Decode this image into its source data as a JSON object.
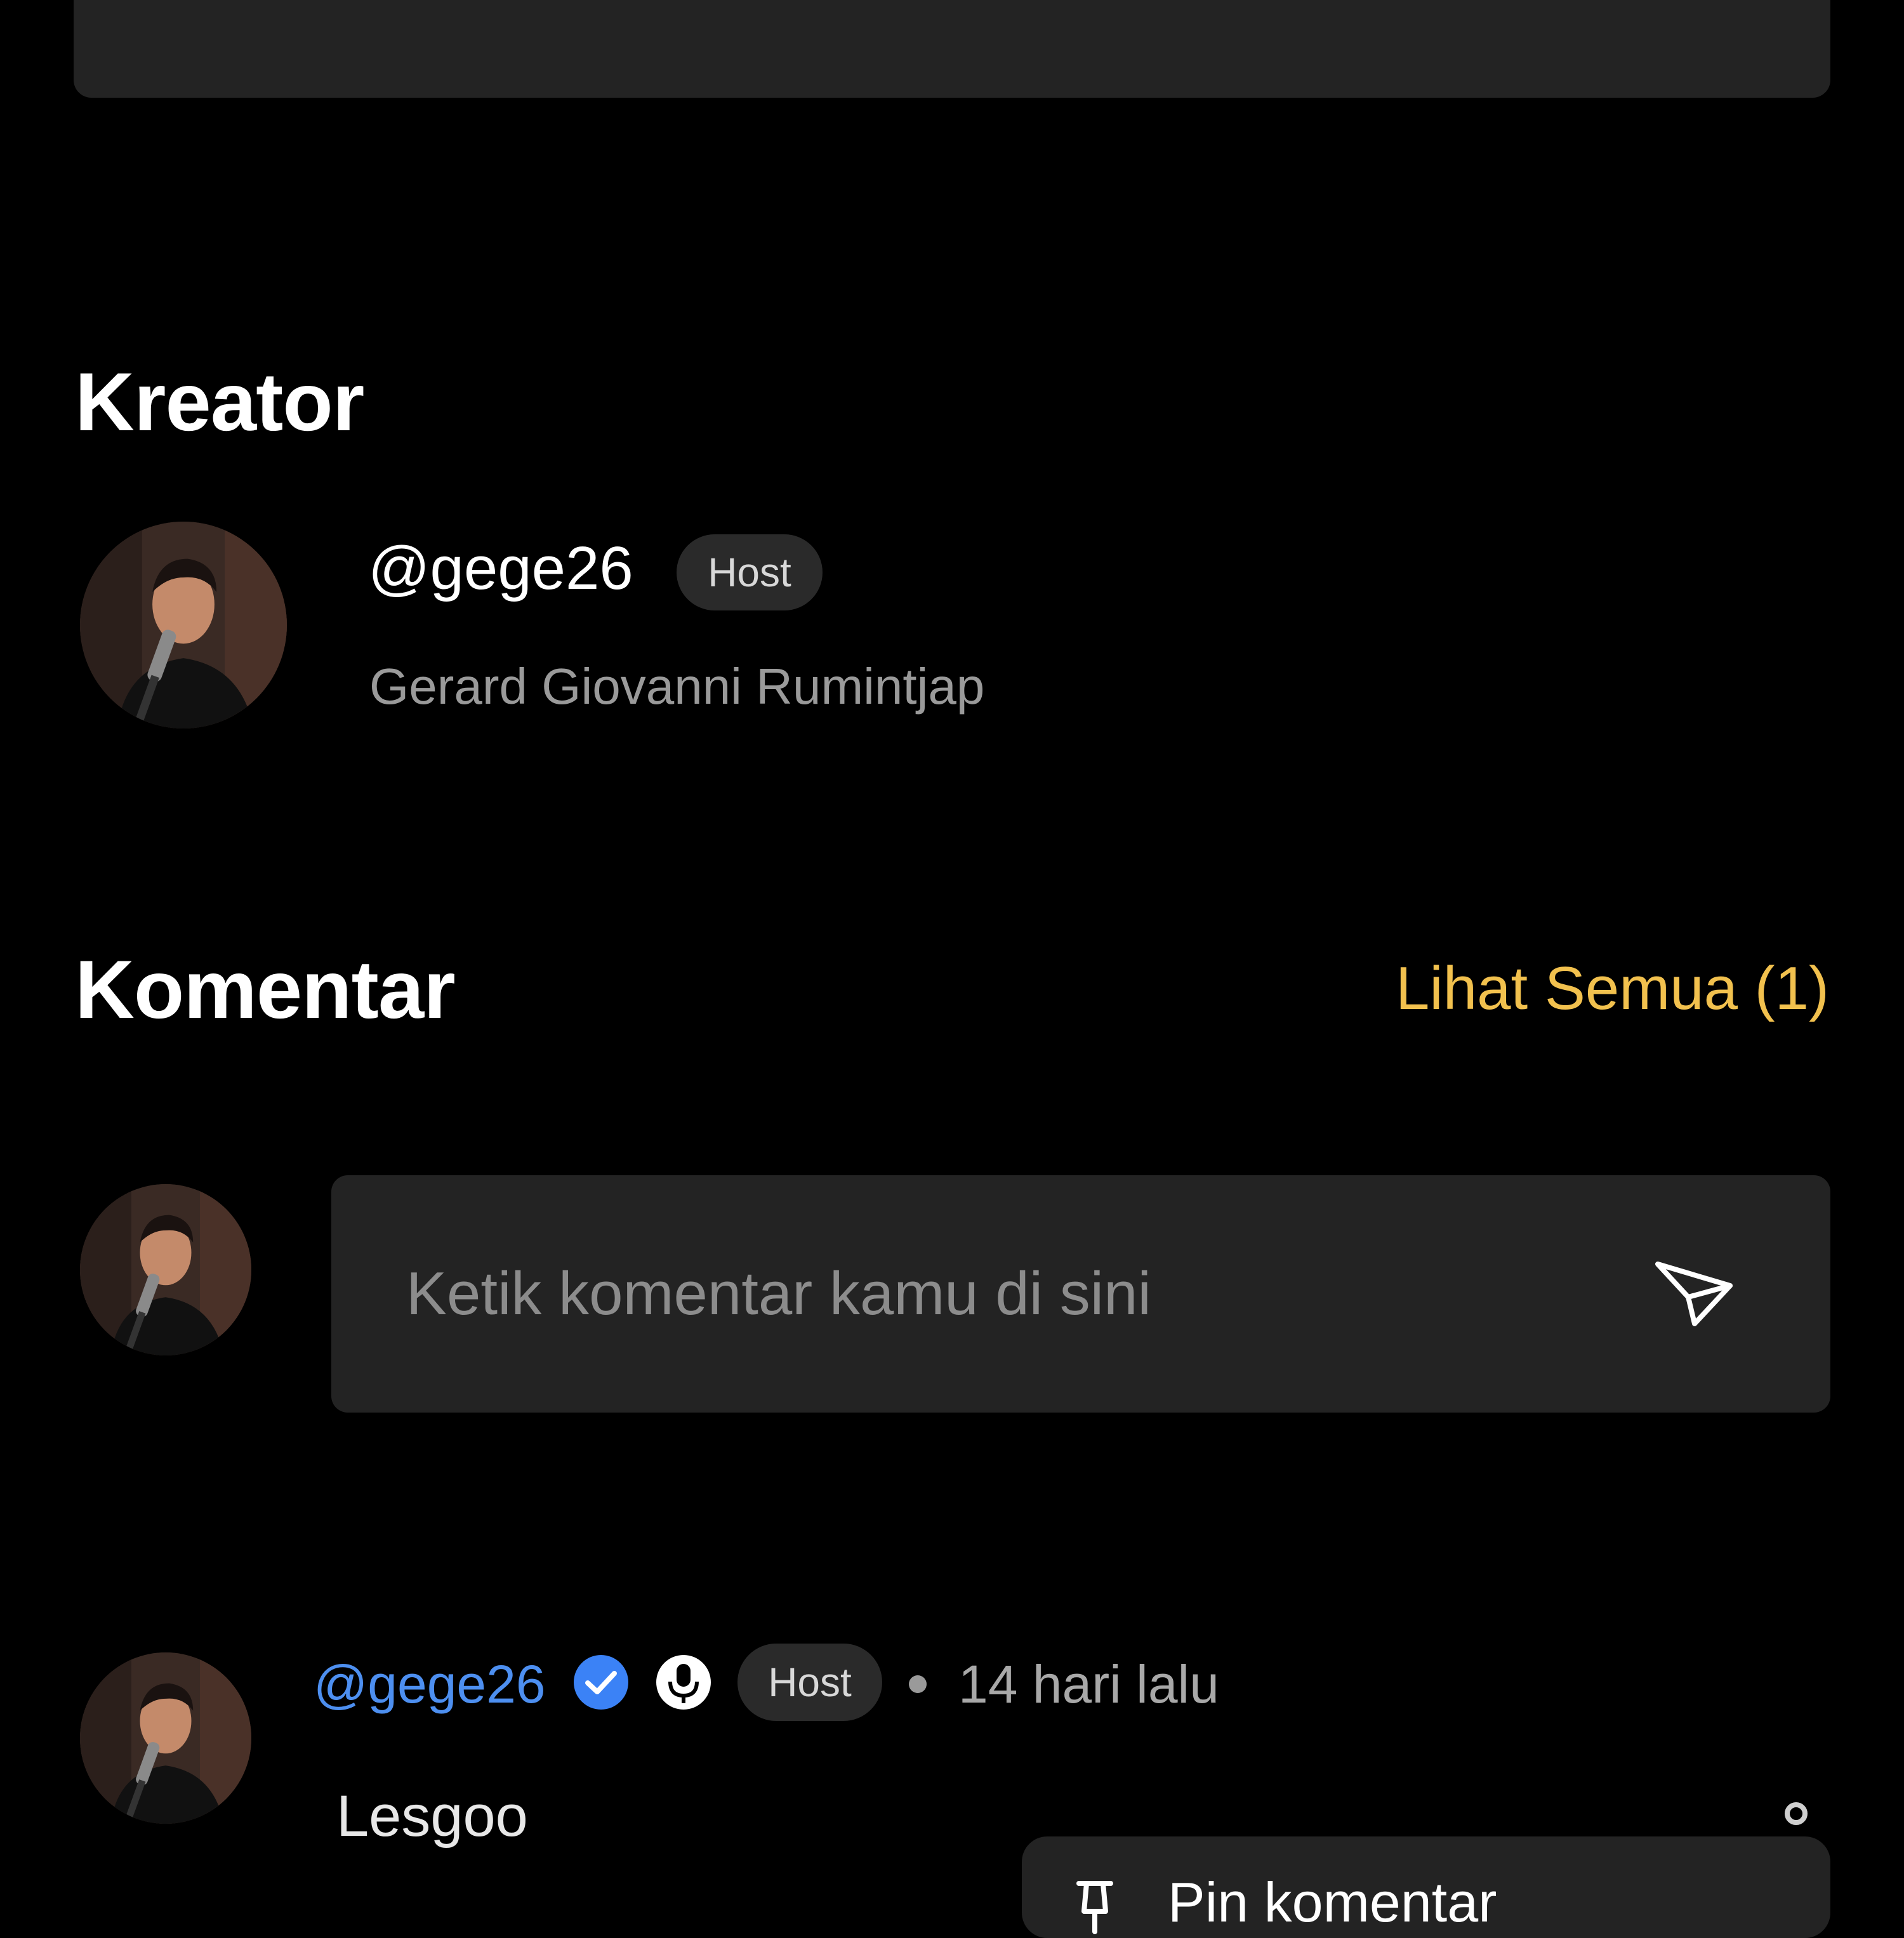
{
  "creator_section": {
    "title": "Kreator",
    "handle": "@gege26",
    "badge": "Host",
    "full_name": "Gerard Giovanni Rumintjap"
  },
  "comments_section": {
    "title": "Komentar",
    "see_all_label": "Lihat Semua (1)",
    "input_placeholder": "Ketik komentar kamu di sini",
    "send_icon": "send-icon"
  },
  "comments": [
    {
      "handle": "@gege26",
      "verified_icon": "verified-icon",
      "role_icon": "microphone-icon",
      "badge": "Host",
      "time": "14 hari lalu",
      "text": "Lesgoo"
    }
  ],
  "context_menu": {
    "items": [
      {
        "label": "Pin komentar",
        "icon": "pin-icon"
      }
    ]
  },
  "colors": {
    "background": "#000000",
    "card": "#232323",
    "accent": "#f2c14e",
    "link": "#4d8ff0",
    "verified": "#3b82f6"
  }
}
